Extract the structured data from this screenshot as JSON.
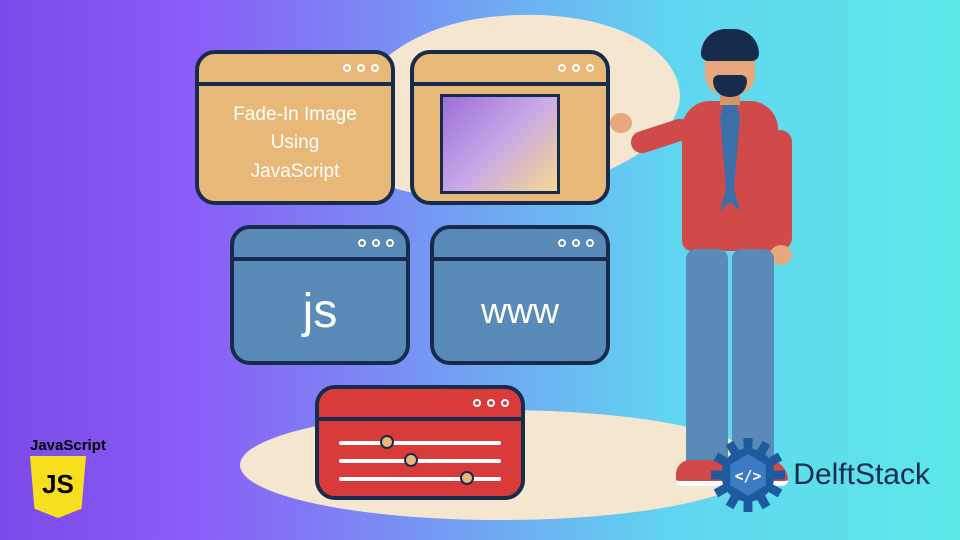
{
  "cards": {
    "title": {
      "line1": "Fade-In Image",
      "line2": "Using",
      "line3": "JavaScript"
    },
    "js": {
      "label": "js"
    },
    "www": {
      "label": "www"
    },
    "sliders": {
      "knobs": [
        25,
        40,
        75
      ]
    }
  },
  "logos": {
    "js": {
      "name": "JavaScript",
      "badge": "JS"
    },
    "delft": {
      "name": "DelftStack"
    }
  },
  "colors": {
    "navy": "#172B4D",
    "tan": "#E8B878",
    "blue": "#5A8BB8",
    "red": "#D14A4A"
  }
}
